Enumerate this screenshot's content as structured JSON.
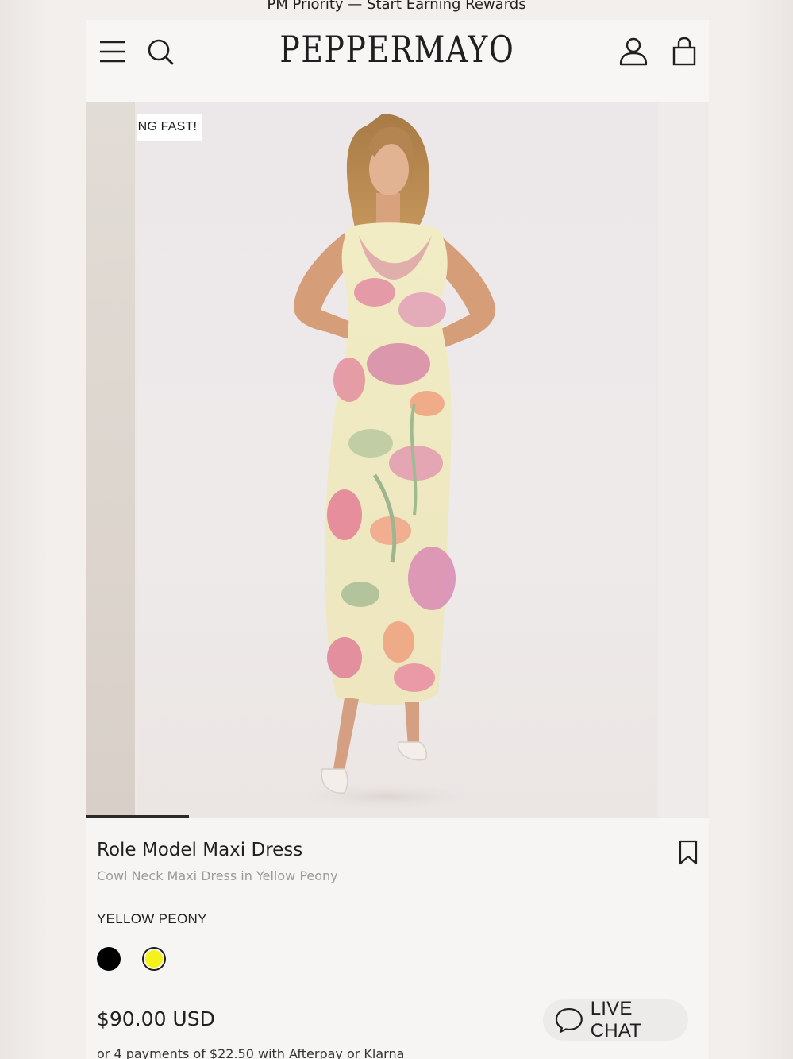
{
  "promo_bar": {
    "text": "PM Priority — Start Earning Rewards"
  },
  "header": {
    "logo": "PEPPERMAYO",
    "icons": [
      "menu-icon",
      "search-icon",
      "account-icon",
      "bag-icon"
    ]
  },
  "gallery": {
    "badge": "SELLING FAST!",
    "progress": 0.166,
    "current_image": "model wearing floral cowl neck maxi dress"
  },
  "product": {
    "title": "Role Model Maxi Dress",
    "subtitle": "Cowl Neck Maxi Dress in Yellow Peony",
    "color_label": "YELLOW PEONY",
    "swatches": [
      {
        "name": "black",
        "color": "#000000",
        "selected": false
      },
      {
        "name": "yellow-peony",
        "color": "#f5f21a",
        "selected": true
      }
    ],
    "price": "$90.00 USD",
    "installments": "or 4 payments of $22.50 with Afterpay or Klarna"
  },
  "chat": {
    "label": "LIVE CHAT"
  }
}
